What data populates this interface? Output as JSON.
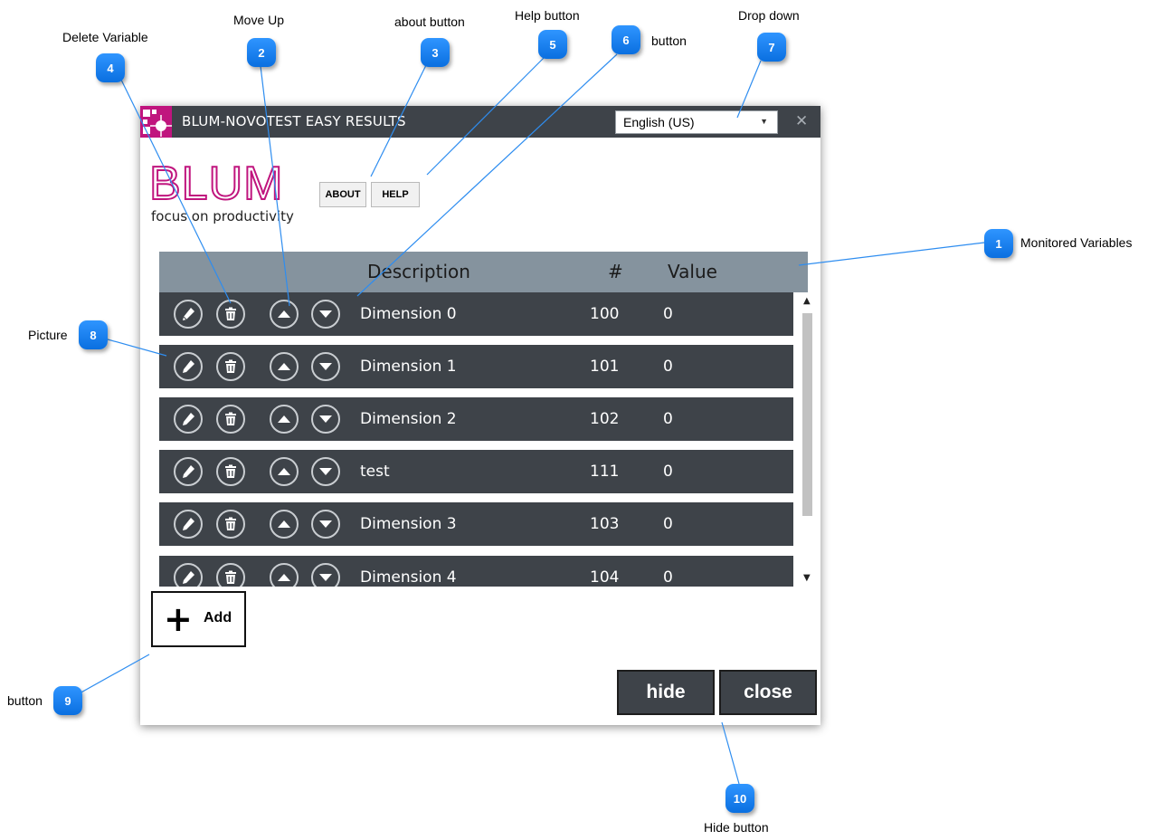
{
  "window": {
    "title": "BLUM-NOVOTEST EASY RESULTS",
    "language_selected": "English (US)",
    "close_glyph": "✕"
  },
  "brand": {
    "logo_text": "BLUM",
    "tagline": "focus on productivity",
    "brand_color": "#c0157e"
  },
  "buttons": {
    "about": "ABOUT",
    "help": "HELP",
    "add": "Add",
    "hide": "hide",
    "close": "close"
  },
  "table": {
    "headers": {
      "description": "Description",
      "number": "#",
      "value": "Value"
    },
    "rows": [
      {
        "description": "Dimension 0",
        "number": "100",
        "value": "0"
      },
      {
        "description": "Dimension 1",
        "number": "101",
        "value": "0"
      },
      {
        "description": "Dimension 2",
        "number": "102",
        "value": "0"
      },
      {
        "description": "test",
        "number": "111",
        "value": "0"
      },
      {
        "description": "Dimension 3",
        "number": "103",
        "value": "0"
      },
      {
        "description": "Dimension 4",
        "number": "104",
        "value": "0"
      }
    ],
    "row_icons": [
      "edit-icon",
      "trash-icon",
      "arrow-up-icon",
      "arrow-down-icon"
    ]
  },
  "callouts": [
    {
      "number": "1",
      "label": "Monitored Variables"
    },
    {
      "number": "2",
      "label": "Move Up"
    },
    {
      "number": "3",
      "label": "about button"
    },
    {
      "number": "4",
      "label": "Delete Variable"
    },
    {
      "number": "5",
      "label": "Help button"
    },
    {
      "number": "6",
      "label": "button"
    },
    {
      "number": "7",
      "label": "Drop down"
    },
    {
      "number": "8",
      "label": "Picture"
    },
    {
      "number": "9",
      "label": "button"
    },
    {
      "number": "10",
      "label": "Hide button"
    }
  ],
  "colors": {
    "titlebar": "#3e4349",
    "row_bg": "#3e4349",
    "header_bg": "#85939e",
    "callout_badge": "#1a7ff0"
  }
}
